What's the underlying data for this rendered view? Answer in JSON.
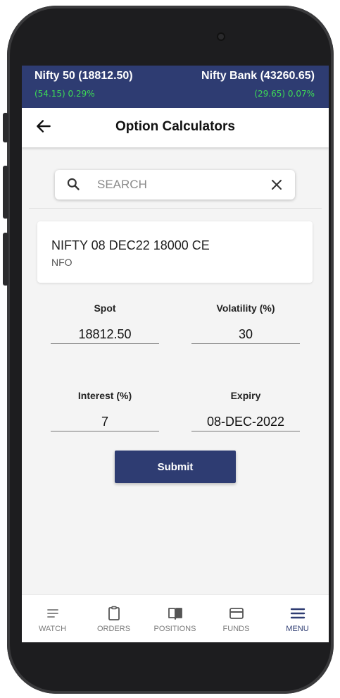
{
  "ticker": {
    "left": {
      "name": "Nifty 50 (18812.50)",
      "change": "(54.15) 0.29%"
    },
    "right": {
      "name": "Nifty Bank (43260.65)",
      "change": "(29.65) 0.07%"
    }
  },
  "header": {
    "title": "Option Calculators"
  },
  "search": {
    "placeholder": "SEARCH"
  },
  "instrument": {
    "name": "NIFTY 08 DEC22 18000 CE",
    "exchange": "NFO"
  },
  "form": {
    "spot": {
      "label": "Spot",
      "value": "18812.50"
    },
    "volatility": {
      "label": "Volatility (%)",
      "value": "30"
    },
    "interest": {
      "label": "Interest (%)",
      "value": "7"
    },
    "expiry": {
      "label": "Expiry",
      "value": "08-DEC-2022"
    },
    "submit_label": "Submit"
  },
  "nav": {
    "items": [
      {
        "label": "WATCH",
        "icon": "list-icon",
        "active": false
      },
      {
        "label": "ORDERS",
        "icon": "clipboard-icon",
        "active": false
      },
      {
        "label": "POSITIONS",
        "icon": "book-icon",
        "active": false
      },
      {
        "label": "FUNDS",
        "icon": "card-icon",
        "active": false
      },
      {
        "label": "MENU",
        "icon": "menu-icon",
        "active": true
      }
    ]
  },
  "colors": {
    "primary": "#2e3c72",
    "positive": "#3ddc55",
    "background": "#f4f4f4"
  }
}
